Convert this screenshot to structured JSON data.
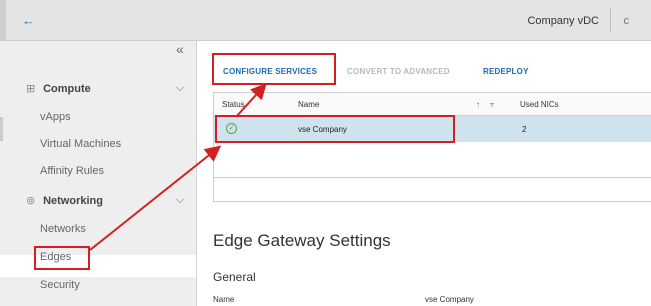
{
  "topbar": {
    "back_icon": "arrow-left-icon",
    "context": "Company vDC",
    "cut_text": "c"
  },
  "sidebar": {
    "collapse_icon": "chevron-double-left-icon",
    "compute": {
      "label": "Compute",
      "icon": "grid-icon",
      "items": [
        "vApps",
        "Virtual Machines",
        "Affinity Rules"
      ]
    },
    "networking": {
      "label": "Networking",
      "icon": "network-icon",
      "items": [
        "Networks",
        "Edges",
        "Security"
      ]
    }
  },
  "toolbar": {
    "configure": "CONFIGURE SERVICES",
    "convert": "CONVERT TO ADVANCED",
    "redeploy": "REDEPLOY"
  },
  "grid": {
    "columns": [
      "Status",
      "Name",
      "Used NICs"
    ],
    "sort_icon": "↑",
    "filter_icon": "▿",
    "rows": [
      {
        "status": "ok",
        "name": "vse Company",
        "used_nics": "2"
      }
    ]
  },
  "details": {
    "title": "Edge Gateway Settings",
    "general": "General",
    "name_key": "Name",
    "name_value": "vse Company"
  },
  "colors": {
    "annotation_red": "#d31f1f",
    "link_blue": "#1b6bb0",
    "row_selected": "#cfe3ef"
  }
}
